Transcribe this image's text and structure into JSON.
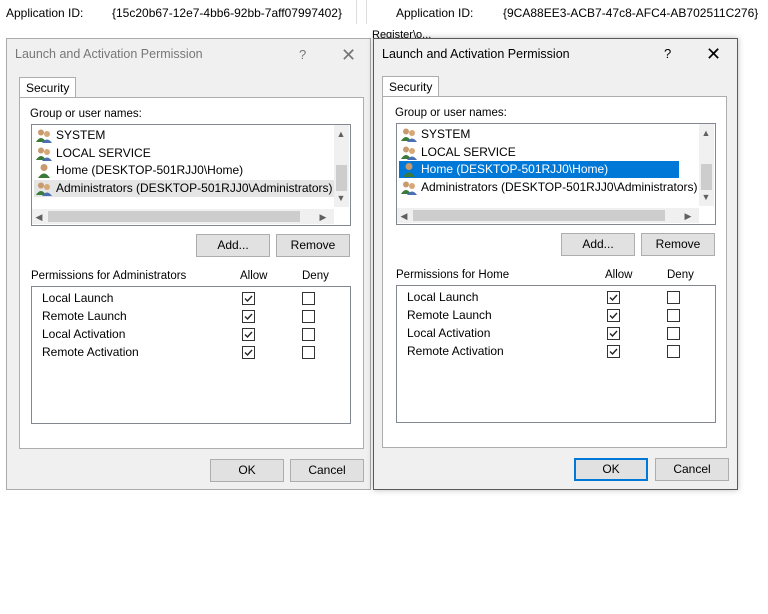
{
  "background": {
    "left_app_id_label": "Application ID:",
    "left_app_id_value": "{15c20b67-12e7-4bb6-92bb-7aff07997402}",
    "right_app_id_label": "Application ID:",
    "right_app_id_value": "{9CA88EE3-ACB7-47c8-AFC4-AB702511C276}",
    "fragment": "Register\\o..."
  },
  "dialogs": [
    {
      "title": "Launch and Activation Permission",
      "help": "?",
      "close": "✕",
      "tab": "Security",
      "group_label": "Group or user names:",
      "users": [
        {
          "name": "SYSTEM",
          "icon": "group-icon"
        },
        {
          "name": "LOCAL SERVICE",
          "icon": "group-icon"
        },
        {
          "name": "Home (DESKTOP-501RJJ0\\Home)",
          "icon": "user-icon"
        },
        {
          "name": "Administrators (DESKTOP-501RJJ0\\Administrators)",
          "icon": "group-icon"
        }
      ],
      "selected_user_index": 3,
      "add_label": "Add...",
      "remove_label": "Remove",
      "permissions_for": "Permissions for Administrators",
      "allow_header": "Allow",
      "deny_header": "Deny",
      "permissions": [
        {
          "name": "Local Launch",
          "allow": true,
          "deny": false
        },
        {
          "name": "Remote Launch",
          "allow": true,
          "deny": false
        },
        {
          "name": "Local Activation",
          "allow": true,
          "deny": false
        },
        {
          "name": "Remote Activation",
          "allow": true,
          "deny": false
        }
      ],
      "ok_label": "OK",
      "cancel_label": "Cancel"
    },
    {
      "title": "Launch and Activation Permission",
      "help": "?",
      "close": "✕",
      "tab": "Security",
      "group_label": "Group or user names:",
      "users": [
        {
          "name": "SYSTEM",
          "icon": "group-icon"
        },
        {
          "name": "LOCAL SERVICE",
          "icon": "group-icon"
        },
        {
          "name": "Home (DESKTOP-501RJJ0\\Home)",
          "icon": "user-icon"
        },
        {
          "name": "Administrators (DESKTOP-501RJJ0\\Administrators)",
          "icon": "group-icon"
        }
      ],
      "selected_user_index": 2,
      "add_label": "Add...",
      "remove_label": "Remove",
      "permissions_for": "Permissions for Home",
      "allow_header": "Allow",
      "deny_header": "Deny",
      "permissions": [
        {
          "name": "Local Launch",
          "allow": true,
          "deny": false
        },
        {
          "name": "Remote Launch",
          "allow": true,
          "deny": false
        },
        {
          "name": "Local Activation",
          "allow": true,
          "deny": false
        },
        {
          "name": "Remote Activation",
          "allow": true,
          "deny": false
        }
      ],
      "ok_label": "OK",
      "cancel_label": "Cancel"
    }
  ],
  "colors": {
    "selection": "#0078d7",
    "dialog_bg": "#f0f0f0",
    "default_button_border": "#0078d7"
  }
}
